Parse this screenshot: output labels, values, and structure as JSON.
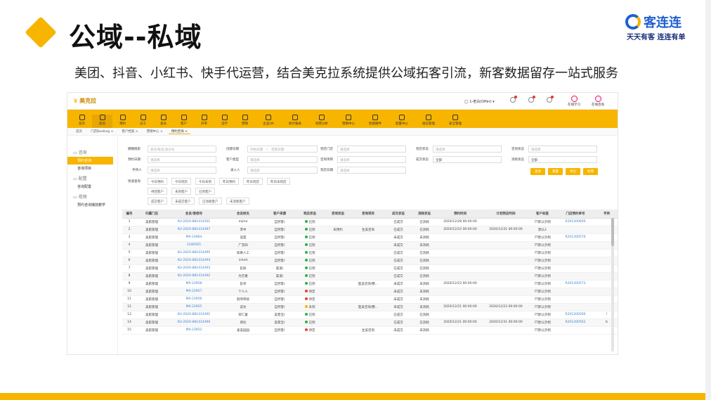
{
  "slide": {
    "title": "公域--私域",
    "subtitle": "美团、抖音、小红书、快手代运营，结合美克拉系统提供公域拓客引流，新客数据留存一站式服务",
    "brand_name": "客连连",
    "brand_slogan": "天天有客 连连有单",
    "accent_color": "#f7b500"
  },
  "app": {
    "logo": "美克拉",
    "user": "1-老白(Offer)",
    "top_right": [
      "在线学习",
      "在线咨询"
    ],
    "nav": [
      "首页",
      "前台",
      "预约",
      "员工",
      "会员",
      "客户",
      "开单",
      "治疗",
      "营销",
      "企业OA",
      "统计报表",
      "经营分析",
      "营销中心",
      "智能硬件",
      "配置中心",
      "短信管理",
      "安全管理"
    ],
    "tabs": [
      "首页",
      "门店Booking",
      "客户档案",
      "营销中心",
      "预约咨询"
    ],
    "sidebar": {
      "sections": [
        {
          "head": "咨询",
          "items": [
            "预约咨询",
            "咨询项目"
          ]
        },
        {
          "head": "配置",
          "items": [
            "咨询配置"
          ]
        },
        {
          "head": "视频",
          "items": [
            "预约咨询播放教学"
          ]
        }
      ]
    },
    "filters": {
      "row1": {
        "l1": "模糊搜索",
        "p1": "会员/姓名/会员号",
        "l2": "创建日期",
        "p2a": "开始日期",
        "p2b": "结束日期",
        "l3": "到店门店",
        "p3": "请选择",
        "l4": "到店状态",
        "p4": "请选择",
        "l5": "咨询状态",
        "p5": "请选择"
      },
      "row2": {
        "l1": "预约日期",
        "p1": "请选择",
        "l2": "客户类型",
        "p2": "请选择",
        "l3": "咨询项目",
        "p3": "请选择",
        "l4": "成交状态",
        "v4": "全部",
        "l5": "消耗状态",
        "v5": "全部"
      },
      "row3": {
        "l1": "手持人",
        "p1": "请选择",
        "l2": "录入人",
        "p2": "请选择",
        "l3": "到店日期",
        "p3": "请选择"
      },
      "buttons": [
        "查询",
        "重置",
        "导出",
        "新增"
      ],
      "quick_label": "快速查询",
      "quick_row1": [
        "今日预约",
        "今日到店",
        "今日未到",
        "昨日预约",
        "昨日到店",
        "昨日未到店"
      ],
      "quick_row2": [
        "待回客户",
        "未到客户",
        "已到客户"
      ],
      "quick_row3": [
        "成交客户",
        "未成交客户",
        "已消耗客户",
        "未消耗客户"
      ]
    },
    "table": {
      "headers": [
        "编号",
        "归属门店",
        "会员/客档号",
        "会员姓名",
        "客户来源",
        "到店状态",
        "咨询状态",
        "咨询项目",
        "成交状态",
        "消耗状态",
        "预约时间",
        "计划到店时间",
        "客户标签",
        "门店预约单号",
        "手持"
      ],
      "rows": [
        [
          "1",
          "美肌管理",
          "KU-2020-881414501",
          "mjmo",
          "自然客/",
          "green",
          "已到",
          "",
          "",
          "已成交",
          "已消耗",
          "2020/12/28 00:00:00",
          "",
          "7T默认示例",
          "R201200600",
          ""
        ],
        [
          "2",
          "美肌管理",
          "KU-2020-881414497",
          "李中",
          "自然客/",
          "green",
          "已到",
          "未预约",
          "生美咨询",
          "已成交",
          "已消耗",
          "2020/12/22 00:00:00",
          "2020/12/31 00:00:00",
          "默认2",
          "",
          ""
        ],
        [
          "3",
          "美肌管理",
          "MX-23964",
          "奕茜",
          "自然客/",
          "green",
          "已到",
          "",
          "",
          "未成交",
          "未消耗",
          "",
          "",
          "7T默认示例",
          "R201200576",
          ""
        ],
        [
          "4",
          "美肌管理",
          "1546565",
          "广忠阳",
          "自然客/",
          "green",
          "已到",
          "",
          "",
          "未成交",
          "未消耗",
          "",
          "",
          "7T默认示例",
          "",
          ""
        ],
        [
          "5",
          "美肌管理",
          "KU-2020-881414495",
          "如果人工",
          "自然客/",
          "green",
          "已到",
          "",
          "",
          "已成交",
          "已消耗",
          "",
          "",
          "7T默认示例",
          "",
          ""
        ],
        [
          "6",
          "美肌管理",
          "KU-2020-881414494",
          "inheit",
          "自然客/",
          "green",
          "已到",
          "",
          "",
          "已成交",
          "已消耗",
          "",
          "",
          "7T默认示例",
          "",
          ""
        ],
        [
          "7",
          "美肌管理",
          "KU-2020-881414493",
          "彭知",
          "渠道/",
          "green",
          "已到",
          "",
          "",
          "已成交",
          "已消耗",
          "",
          "",
          "7T默认示例",
          "",
          ""
        ],
        [
          "8",
          "美肌管理",
          "KU-2020-881414492",
          "为京重",
          "渠道/",
          "green",
          "已到",
          "",
          "",
          "已成交",
          "已消耗",
          "",
          "",
          "7T默认示例",
          "",
          ""
        ],
        [
          "9",
          "美肌管理",
          "MX-23958",
          "彭祁",
          "自然客/",
          "green",
          "已到",
          "",
          "医美咨询/整...",
          "未成交",
          "未消耗",
          "2020/12/22 00:00:00",
          "",
          "7T默认示例",
          "R201200573",
          ""
        ],
        [
          "10",
          "美肌管理",
          "MX-23957",
          "个人人",
          "自然客/",
          "red",
          "待定",
          "",
          "",
          "未成交",
          "未消耗",
          "",
          "",
          "7T默认示例",
          "",
          ""
        ],
        [
          "11",
          "美肌管理",
          "MX-23956",
          "刮项审核",
          "自然客/",
          "red",
          "待定",
          "",
          "",
          "未成交",
          "未消耗",
          "",
          "",
          "7T默认示例",
          "",
          ""
        ],
        [
          "12",
          "美肌管理",
          "MX-23955",
          "说达",
          "自然客/",
          "orange",
          "未到",
          "",
          "医美咨询/整...",
          "未成交",
          "未消耗",
          "2020/12/21 00:00:00",
          "2020/12/23 00:00:00",
          "7T默认示例",
          "",
          ""
        ],
        [
          "13",
          "美肌管理",
          "KU-2020-881414491",
          "荣仁童",
          "美客宝/",
          "green",
          "已到",
          "",
          "",
          "已成交",
          "已消耗",
          "",
          "",
          "7T默认示例",
          "R201200566",
          "!"
        ],
        [
          "14",
          "美肌管理",
          "KU-2020-881414490",
          "郑达",
          "美客宝/",
          "green",
          "已到",
          "",
          "",
          "已成交",
          "已消耗",
          "2020/12/21 00:00:00",
          "2020/12/31 00:00:00",
          "7T默认示例",
          "R201200562",
          "b"
        ],
        [
          "15",
          "美肌管理",
          "MX-23952",
          "柔美园园",
          "自然客/",
          "red",
          "待定",
          "",
          "生美咨询",
          "未成交",
          "未消耗",
          "",
          "",
          "7T默认示例",
          "",
          ""
        ]
      ]
    }
  }
}
